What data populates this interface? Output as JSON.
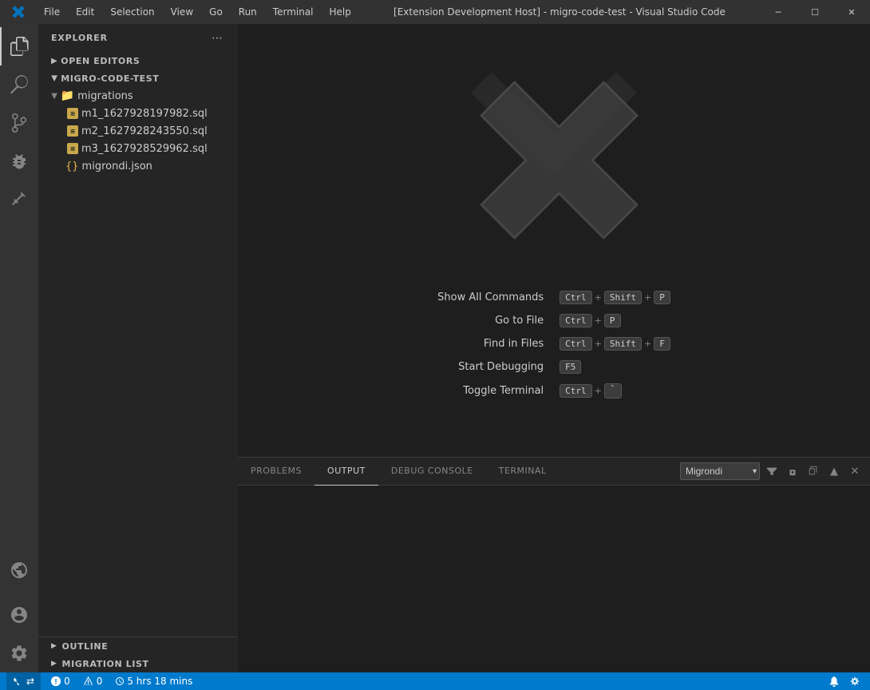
{
  "titlebar": {
    "title": "[Extension Development Host] - migro-code-test - Visual Studio Code",
    "menu": [
      "File",
      "Edit",
      "Selection",
      "View",
      "Go",
      "Run",
      "Terminal",
      "Help"
    ],
    "controls": [
      "─",
      "☐",
      "✕"
    ]
  },
  "activity_bar": {
    "items": [
      {
        "name": "explorer",
        "icon": "files"
      },
      {
        "name": "search",
        "icon": "search"
      },
      {
        "name": "source-control",
        "icon": "source-control"
      },
      {
        "name": "debug",
        "icon": "debug"
      },
      {
        "name": "extensions",
        "icon": "extensions"
      },
      {
        "name": "remote-explorer",
        "icon": "remote"
      },
      {
        "name": "account",
        "icon": "account"
      },
      {
        "name": "settings",
        "icon": "settings"
      }
    ]
  },
  "sidebar": {
    "title": "EXPLORER",
    "sections": {
      "open_editors": "OPEN EDITORS",
      "project": "MIGRO-CODE-TEST"
    },
    "tree": {
      "migrations_folder": "migrations",
      "files": [
        "m1_1627928197982.sql",
        "m2_1627928243550.sql",
        "m3_1627928529962.sql"
      ],
      "root_files": [
        "migrondi.json"
      ]
    },
    "bottom": {
      "outline": "OUTLINE",
      "migration_list": "MIGRATION LIST"
    }
  },
  "welcome": {
    "shortcuts": [
      {
        "label": "Show All Commands",
        "keys": [
          "Ctrl",
          "+",
          "Shift",
          "+",
          "P"
        ]
      },
      {
        "label": "Go to File",
        "keys": [
          "Ctrl",
          "+",
          "P"
        ]
      },
      {
        "label": "Find in Files",
        "keys": [
          "Ctrl",
          "+",
          "Shift",
          "+",
          "F"
        ]
      },
      {
        "label": "Start Debugging",
        "keys": [
          "F5"
        ]
      },
      {
        "label": "Toggle Terminal",
        "keys": [
          "Ctrl",
          "+",
          "`"
        ]
      }
    ]
  },
  "panel": {
    "tabs": [
      "PROBLEMS",
      "OUTPUT",
      "DEBUG CONSOLE",
      "TERMINAL"
    ],
    "active_tab": "OUTPUT",
    "dropdown": {
      "selected": "Migrondi",
      "options": [
        "Migrondi"
      ]
    }
  },
  "statusbar": {
    "left_items": [
      {
        "icon": "remote",
        "text": ""
      },
      {
        "icon": "error",
        "text": "0"
      },
      {
        "icon": "warning",
        "text": "0"
      },
      {
        "icon": "clock",
        "text": "5 hrs 18 mins"
      }
    ],
    "right_items": [
      {
        "text": "🔔"
      },
      {
        "text": "⚙"
      }
    ]
  }
}
